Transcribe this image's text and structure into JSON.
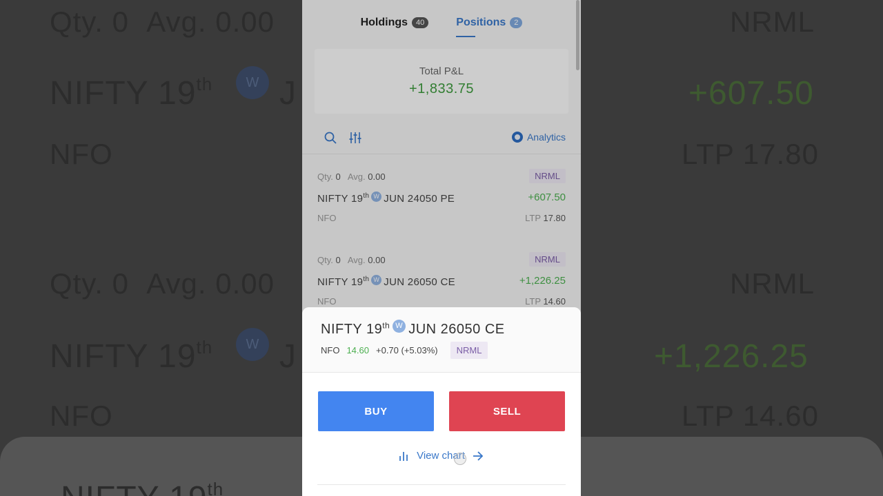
{
  "tabs": {
    "holdings": {
      "label": "Holdings",
      "count": "40"
    },
    "positions": {
      "label": "Positions",
      "count": "2"
    }
  },
  "total_pnl": {
    "label": "Total P&L",
    "value": "+1,833.75"
  },
  "toolbar": {
    "analytics_label": "Analytics",
    "search_icon": "search-icon",
    "filter_icon": "filter-sliders-icon"
  },
  "positions": [
    {
      "qty_label": "Qty.",
      "qty": "0",
      "avg_label": "Avg.",
      "avg": "0.00",
      "product": "NRML",
      "name_pre": "NIFTY 19",
      "name_sup": "th",
      "weekly": "W",
      "name_post": "JUN 24050 PE",
      "pnl": "+607.50",
      "exchange": "NFO",
      "ltp_label": "LTP",
      "ltp": "17.80"
    },
    {
      "qty_label": "Qty.",
      "qty": "0",
      "avg_label": "Avg.",
      "avg": "0.00",
      "product": "NRML",
      "name_pre": "NIFTY 19",
      "name_sup": "th",
      "weekly": "W",
      "name_post": "JUN 26050 CE",
      "pnl": "+1,226.25",
      "exchange": "NFO",
      "ltp_label": "LTP",
      "ltp": "14.60"
    }
  ],
  "sheet": {
    "name_pre": "NIFTY 19",
    "name_sup": "th",
    "weekly": "W",
    "name_post": "JUN 26050 CE",
    "exchange": "NFO",
    "ltp": "14.60",
    "change": "+0.70 (+5.03%)",
    "product": "NRML",
    "buy_label": "BUY",
    "sell_label": "SELL",
    "view_chart_label": "View chart"
  },
  "colors": {
    "accent": "#3a78c9",
    "buy": "#4385f0",
    "sell": "#df4452",
    "profit": "#4caf50"
  }
}
